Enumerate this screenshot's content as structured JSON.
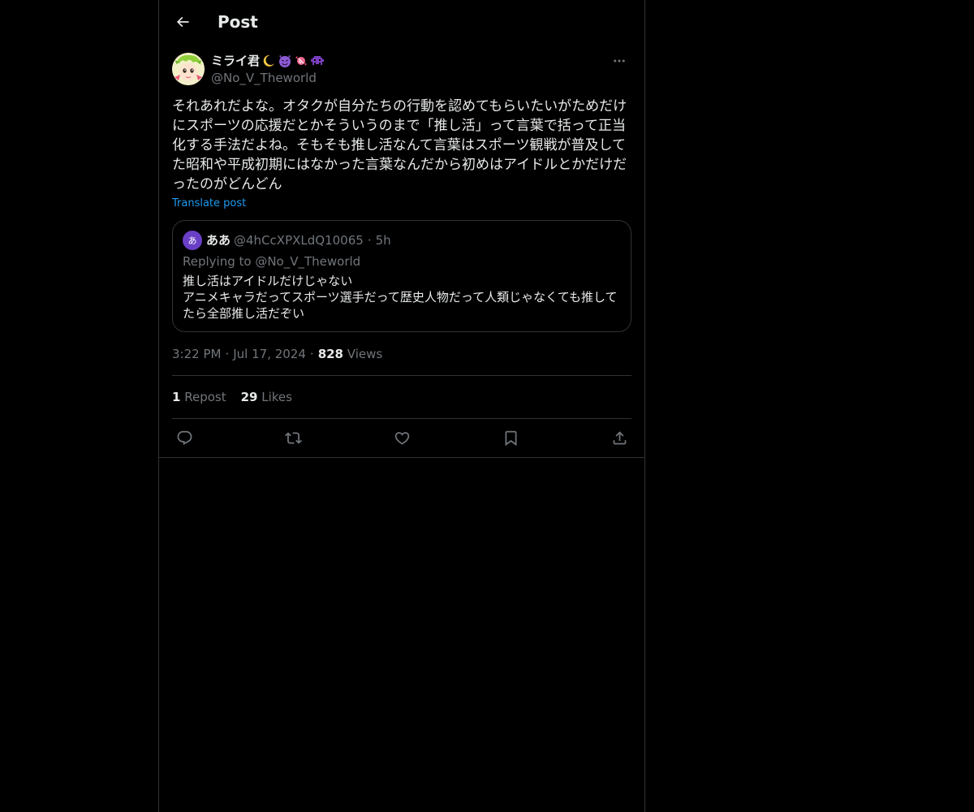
{
  "header": {
    "title": "Post"
  },
  "post": {
    "author": {
      "display_name": "ミライ君",
      "emojis": [
        "crescent-moon",
        "smiling-devil",
        "candy",
        "alien-monster"
      ],
      "handle": "@No_V_Theworld"
    },
    "text": "それあれだよな。オタクが自分たちの行動を認めてもらいたいがためだけにスポーツの応援だとかそういうのまで「推し活」って言葉で括って正当化する手法だよね。そもそも推し活なんて言葉はスポーツ観戦が普及してた昭和や平成初期にはなかった言葉なんだから初めはアイドルとかだけだったのがどんどん",
    "translate_label": "Translate post",
    "timestamp": {
      "time": "3:22 PM",
      "date": "Jul 17, 2024",
      "views_count": "828",
      "views_label": "Views"
    },
    "stats": {
      "reposts_count": "1",
      "reposts_label": "Repost",
      "likes_count": "29",
      "likes_label": "Likes"
    }
  },
  "quote": {
    "avatar_glyph": "あ",
    "name": "ああ",
    "handle": "@4hCcXPXLdQ10065",
    "time": "5h",
    "replying_to": "Replying to @No_V_Theworld",
    "text": "推し活はアイドルだけじゃない\nアニメキャラだってスポーツ選手だって歴史人物だって人類じゃなくても推してたら全部推し活だぞい"
  },
  "separators": {
    "dot": "·"
  },
  "colors": {
    "background": "#000000",
    "text_primary": "#e7e9ea",
    "text_secondary": "#71767b",
    "accent": "#1d9bf0",
    "border": "#2f3336"
  },
  "icons": [
    "back-arrow-icon",
    "more-icon",
    "reply-icon",
    "repost-icon",
    "like-icon",
    "bookmark-icon",
    "share-icon"
  ]
}
